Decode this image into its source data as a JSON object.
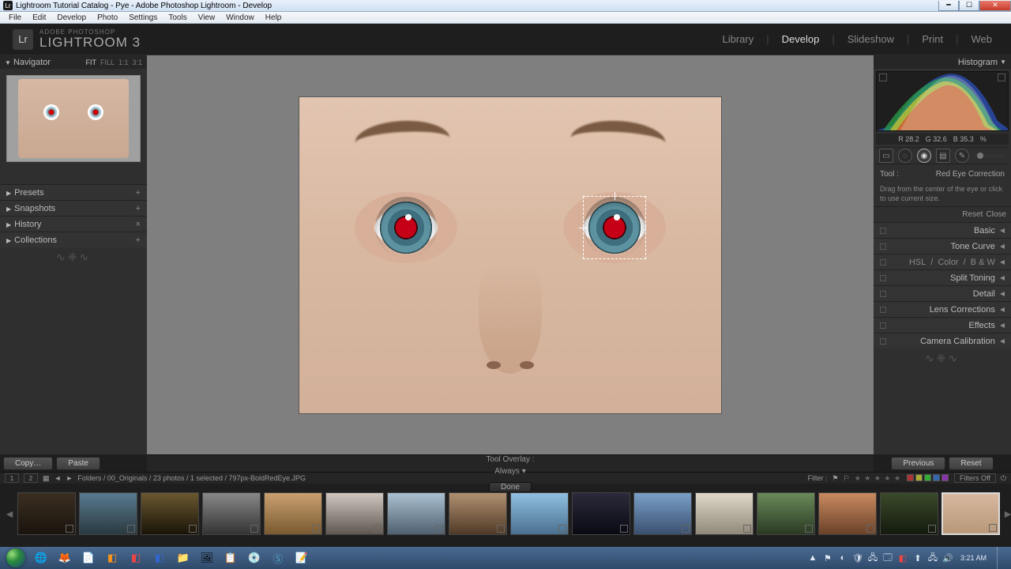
{
  "window": {
    "title": "Lightroom Tutorial Catalog - Pye - Adobe Photoshop Lightroom - Develop"
  },
  "menubar": [
    "File",
    "Edit",
    "Develop",
    "Photo",
    "Settings",
    "Tools",
    "View",
    "Window",
    "Help"
  ],
  "header": {
    "adobe": "ADOBE PHOTOSHOP",
    "product": "LIGHTROOM 3",
    "logo": "Lr",
    "modules": [
      "Library",
      "Develop",
      "Slideshow",
      "Print",
      "Web"
    ],
    "active_module": "Develop"
  },
  "left": {
    "navigator": {
      "title": "Navigator",
      "zoom": [
        "FIT",
        "FILL",
        "1:1",
        "3:1"
      ]
    },
    "groups": [
      {
        "label": "Presets",
        "plus": "+"
      },
      {
        "label": "Snapshots",
        "plus": "+"
      },
      {
        "label": "History",
        "plus": "×"
      },
      {
        "label": "Collections",
        "plus": "+"
      }
    ],
    "copy_btn": "Copy…",
    "paste_btn": "Paste"
  },
  "center": {
    "tool_overlay_label": "Tool Overlay :",
    "tool_overlay_value": "Always",
    "done_btn": "Done"
  },
  "right": {
    "histogram_title": "Histogram",
    "rgb": {
      "r": "R  28.2",
      "g": "G  32.6",
      "b": "B  35.3",
      "pct": "%"
    },
    "tool": {
      "label": "Tool :",
      "name": "Red Eye Correction",
      "hint": "Drag from the center of the eye or click to use current size.",
      "reset": "Reset",
      "close": "Close"
    },
    "sections": [
      "Basic",
      "Tone Curve",
      "Split Toning",
      "Detail",
      "Lens Corrections",
      "Effects",
      "Camera Calibration"
    ],
    "hsl_row": {
      "hsl": "HSL",
      "color": "Color",
      "bw": "B & W"
    },
    "previous_btn": "Previous",
    "reset_btn": "Reset"
  },
  "filmstrip": {
    "view1": "1",
    "view2": "2",
    "crumb": "Folders / 00_Originals / 23 photos / 1 selected / 797px-BoldRedEye.JPG",
    "filter_label": "Filter :",
    "filters_off": "Filters Off",
    "thumb_count": 16
  },
  "taskbar": {
    "time": "3:21 AM",
    "date": "",
    "tray_count": 11
  }
}
